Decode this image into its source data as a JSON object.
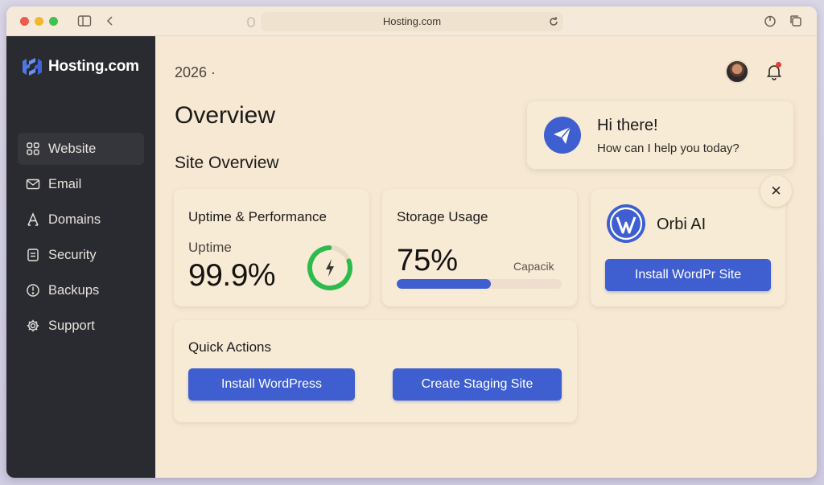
{
  "browser": {
    "url": "Hosting.com",
    "icons": [
      "sidebar-toggle-icon",
      "back-chevron-icon",
      "lock-icon",
      "reload-icon",
      "power-icon",
      "tabs-icon"
    ]
  },
  "sidebar": {
    "brand": "Hosting.com",
    "items": [
      {
        "label": "Website",
        "icon": "grid-icon",
        "active": true
      },
      {
        "label": "Email",
        "icon": "mail-icon",
        "active": false
      },
      {
        "label": "Domains",
        "icon": "domains-icon",
        "active": false
      },
      {
        "label": "Security",
        "icon": "security-icon",
        "active": false
      },
      {
        "label": "Backups",
        "icon": "backups-icon",
        "active": false
      },
      {
        "label": "Support",
        "icon": "gear-icon",
        "active": false
      }
    ]
  },
  "header": {
    "year": "2026 ·",
    "title": "Overview",
    "section": "Site Overview"
  },
  "uptime": {
    "title": "Uptime & Performance",
    "label": "Uptime",
    "value": "99.9%",
    "ring_level": 0.8,
    "ring_color": "#2dbb4c"
  },
  "storage": {
    "title": "Storage Usage",
    "value": "75%",
    "caption": "Capacik",
    "fill_level": 0.57
  },
  "orbi": {
    "name": "Orbi AI",
    "button": "Install WordPr Site"
  },
  "quick_actions": {
    "title": "Quick Actions",
    "install_button": "Install WordPress",
    "staging_button": "Create Staging Site"
  },
  "chat": {
    "title": "Hi there!",
    "subtitle": "How can I help you today?",
    "close": "✕"
  },
  "colors": {
    "accent": "#3f5fd0",
    "sidebar_bg": "#2a2b30",
    "page_bg": "#f6e8d3",
    "success": "#2dbb4c"
  }
}
